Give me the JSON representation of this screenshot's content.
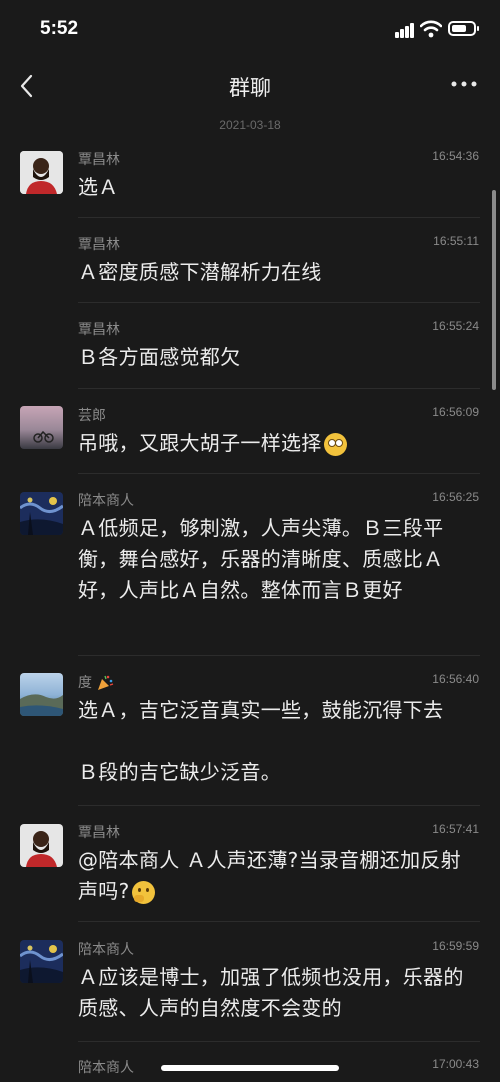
{
  "status_bar": {
    "time": "5:52"
  },
  "nav": {
    "title": "群聊"
  },
  "date_separator": "2021-03-18",
  "messages": [
    {
      "sender": "覃昌林",
      "time": "16:54:36",
      "text": "选Ａ",
      "avatar": "man-beard-red-shirt"
    },
    {
      "sender": "覃昌林",
      "time": "16:55:11",
      "text": "Ａ密度质感下潜解析力在线"
    },
    {
      "sender": "覃昌林",
      "time": "16:55:24",
      "text": "Ｂ各方面感觉都欠"
    },
    {
      "sender": "芸郎",
      "time": "16:56:09",
      "text": "吊哦，又跟大胡子一样选择",
      "emoji": "face-with-rolling-eyes",
      "avatar": "sunset-bike"
    },
    {
      "sender": "陪本商人",
      "time": "16:56:25",
      "text": "Ａ低频足，够刺激，人声尖薄。Ｂ三段平衡，舞台感好，乐器的清晰度、质感比Ａ好，人声比Ａ自然。整体而言Ｂ更好",
      "avatar": "starry-night"
    },
    {
      "sender": "度",
      "sender_emoji": "party-popper",
      "time": "16:56:40",
      "text": "选Ａ，吉它泛音真实一些，鼓能沉得下去",
      "text2": "Ｂ段的吉它缺少泛音。",
      "avatar": "coast-landscape"
    },
    {
      "sender": "覃昌林",
      "time": "16:57:41",
      "text": "@陪本商人 Ａ人声还薄?当录音棚还加反射声吗?",
      "emoji": "thinking-face",
      "avatar": "man-beard-red-shirt"
    },
    {
      "sender": "陪本商人",
      "time": "16:59:59",
      "text": "Ａ应该是博士，加强了低频也没用，乐器的质感、人声的自然度不会变的",
      "avatar": "starry-night"
    },
    {
      "sender": "陪本商人",
      "time": "17:00:43",
      "text": ""
    }
  ]
}
